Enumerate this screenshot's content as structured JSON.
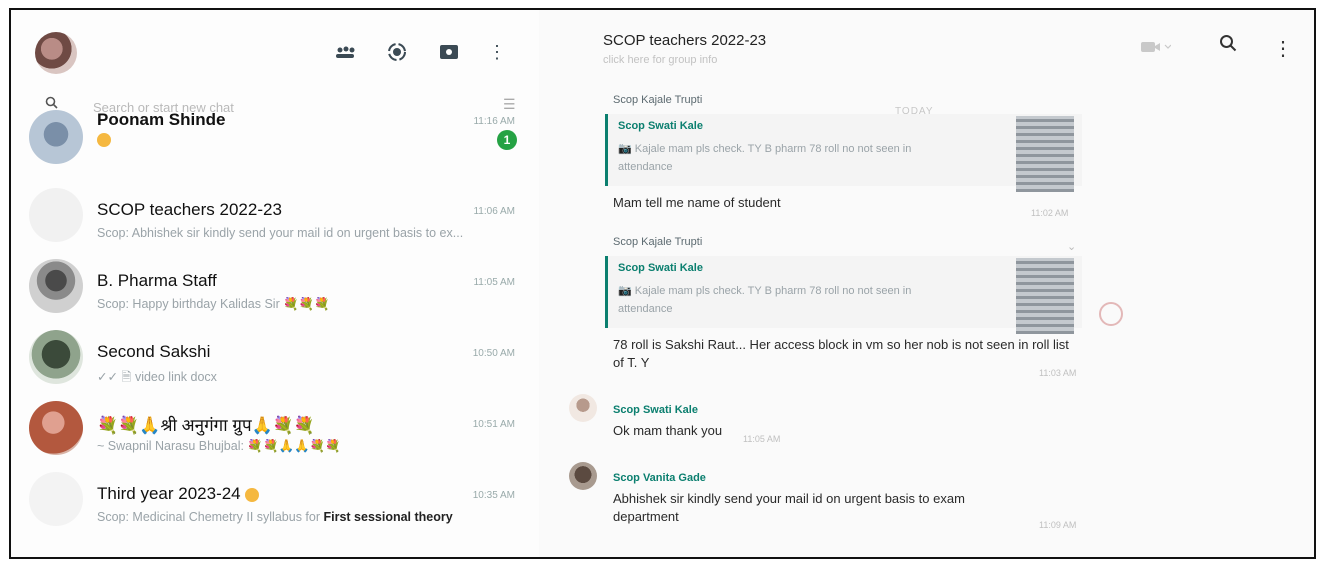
{
  "left_header": {
    "icons": [
      "communities-icon",
      "status-icon",
      "channels-icon",
      "menu-icon"
    ]
  },
  "search": {
    "placeholder": "Search or start new chat"
  },
  "chats": [
    {
      "name": "Poonam Shinde",
      "time": "11:16 AM",
      "preview": "",
      "unread": "1"
    },
    {
      "name": "SCOP teachers 2022-23",
      "time": "11:06 AM",
      "preview": "Scop: Abhishek sir kindly send your mail id on urgent basis to ex..."
    },
    {
      "name": "B. Pharma Staff",
      "time": "11:05 AM",
      "preview": "Scop: Happy birthday Kalidas Sir 💐💐💐"
    },
    {
      "name": "Second Sakshi",
      "time": "10:50 AM",
      "preview": "✓✓ 🗎 video link docx"
    },
    {
      "name": "💐💐🙏श्री अनुगंगा ग्रुप🙏💐💐",
      "time": "10:51 AM",
      "preview": "~ Swapnil Narasu Bhujbal: 💐💐🙏🙏💐💐"
    },
    {
      "name": "Third year 2023-24",
      "time": "10:35 AM",
      "preview_prefix": "Scop: Medicinal Chemetry II syllabus for ",
      "preview_bold": "First sessional theory"
    }
  ],
  "conversation": {
    "title": "SCOP teachers 2022-23",
    "subtitle": "click here for group info",
    "day_label": "TODAY",
    "messages": [
      {
        "sender": "Scop Kajale Trupti",
        "quote_name": "Scop Swati Kale",
        "quote_text": "📷 Kajale mam pls check. TY B pharm 78 roll no not seen in attendance",
        "text": "Mam tell me name of student",
        "time": "11:02 AM"
      },
      {
        "sender": "Scop Kajale Trupti",
        "quote_name": "Scop Swati Kale",
        "quote_text": "📷 Kajale mam pls check. TY B pharm 78 roll no not seen in attendance",
        "text": "78 roll is Sakshi Raut... Her access block in vm so her nob is not seen in roll list of T. Y",
        "time": "11:03 AM"
      },
      {
        "sender": "Scop Swati Kale",
        "text": "Ok mam thank you",
        "time": "11:05 AM"
      },
      {
        "sender": "Scop Vanita Gade",
        "text": "Abhishek sir kindly send your mail id on urgent basis to exam department",
        "time": "11:09 AM"
      }
    ]
  },
  "colors": {
    "accent_green": "#0b7f6f",
    "unread_badge": "#25a244"
  }
}
